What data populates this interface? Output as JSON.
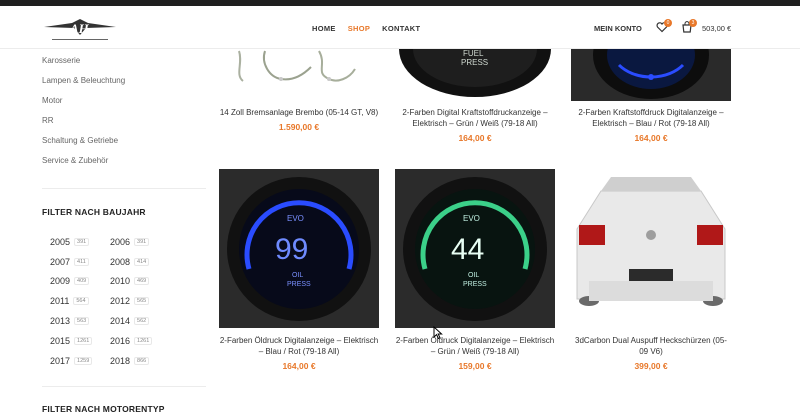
{
  "nav": {
    "items": [
      {
        "label": "HOME",
        "active": false
      },
      {
        "label": "SHOP",
        "active": true
      },
      {
        "label": "KONTAKT",
        "active": false
      }
    ],
    "account": "MEIN KONTO",
    "wishlist_count": "0",
    "cart_count": "3",
    "cart_total": "503,00 €"
  },
  "sidebar": {
    "categories": [
      "Karosserie",
      "Lampen & Beleuchtung",
      "Motor",
      "RR",
      "Schaltung & Getriebe",
      "Service & Zubehör"
    ],
    "filter_year_title": "FILTER NACH BAUJAHR",
    "years": [
      {
        "year": "2005",
        "count": "391"
      },
      {
        "year": "2006",
        "count": "391"
      },
      {
        "year": "2007",
        "count": "411"
      },
      {
        "year": "2008",
        "count": "414"
      },
      {
        "year": "2009",
        "count": "409"
      },
      {
        "year": "2010",
        "count": "469"
      },
      {
        "year": "2011",
        "count": "564"
      },
      {
        "year": "2012",
        "count": "565"
      },
      {
        "year": "2013",
        "count": "563"
      },
      {
        "year": "2014",
        "count": "562"
      },
      {
        "year": "2015",
        "count": "1261"
      },
      {
        "year": "2016",
        "count": "1261"
      },
      {
        "year": "2017",
        "count": "1259"
      },
      {
        "year": "2018",
        "count": "866"
      }
    ],
    "filter_engine_title": "FILTER NACH MOTORENTYP"
  },
  "products": [
    {
      "title": "14 Zoll Bremsanlage Brembo (05-14 GT, V8)",
      "price": "1.590,00 €"
    },
    {
      "title": "2-Farben Digital Kraftstoffdruckanzeige – Elektrisch – Grün / Weiß (79-18 All)",
      "price": "164,00 €"
    },
    {
      "title": "2-Farben Kraftstoffdruck Digitalanzeige – Elektrisch – Blau / Rot (79-18 All)",
      "price": "164,00 €"
    },
    {
      "title": "2-Farben Öldruck Digitalanzeige – Elektrisch – Blau / Rot (79-18 All)",
      "price": "164,00 €"
    },
    {
      "title": "2-Farben Öldruck Digitalanzeige – Elektrisch – Grün / Weiß (79-18 All)",
      "price": "159,00 €"
    },
    {
      "title": "3dCarbon Dual Auspuff Heckschürzen (05-09 V6)",
      "price": "399,00 €"
    }
  ],
  "gauges": {
    "g1_top": "FUEL",
    "g1_bottom": "PRESS",
    "g4_top": "EVO",
    "g4_value": "99",
    "g4_bottom1": "OIL",
    "g4_bottom2": "PRESS",
    "g5_top": "EVO",
    "g5_value": "44",
    "g5_bottom1": "OIL",
    "g5_bottom2": "PRESS"
  },
  "colors": {
    "accent": "#e8782a",
    "blue": "#2a4cff",
    "green": "#3bd089"
  }
}
